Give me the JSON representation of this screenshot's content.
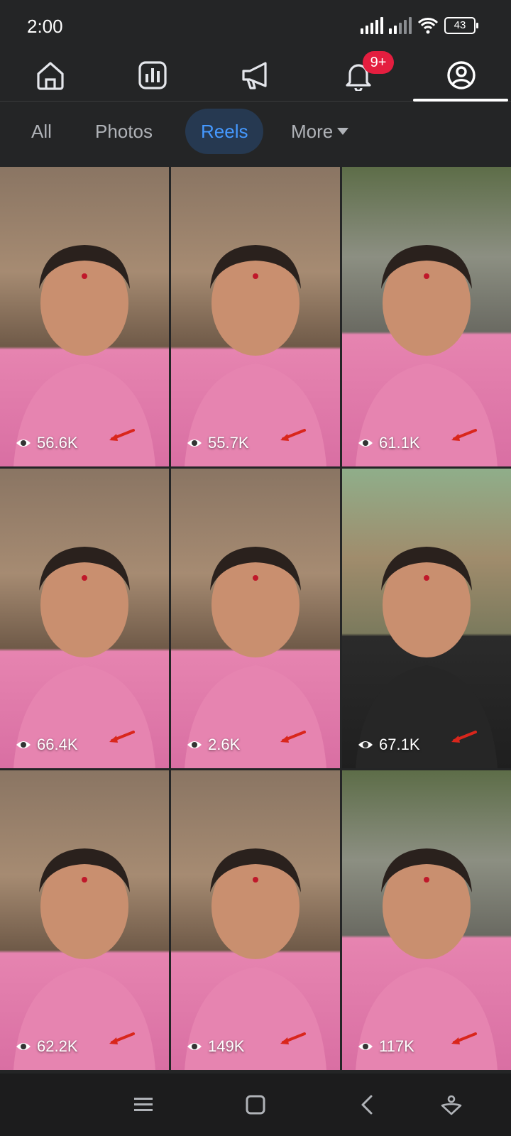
{
  "status_bar": {
    "time": "2:00",
    "battery": "43"
  },
  "nav": {
    "items": [
      {
        "name": "home",
        "icon": "home-icon"
      },
      {
        "name": "dashboard",
        "icon": "bar-chart-icon"
      },
      {
        "name": "ads",
        "icon": "megaphone-icon"
      },
      {
        "name": "notifications",
        "icon": "bell-icon",
        "badge": "9+"
      },
      {
        "name": "profile",
        "icon": "profile-icon",
        "active": true
      }
    ]
  },
  "filters": {
    "all": "All",
    "photos": "Photos",
    "reels": "Reels",
    "more": "More",
    "selected": "Reels"
  },
  "reels": [
    {
      "views": "56.6K",
      "scene": "indoor"
    },
    {
      "views": "55.7K",
      "scene": "indoor"
    },
    {
      "views": "61.1K",
      "scene": "outdoor"
    },
    {
      "views": "66.4K",
      "scene": "indoor"
    },
    {
      "views": "2.6K",
      "scene": "indoor"
    },
    {
      "views": "67.1K",
      "scene": "village"
    },
    {
      "views": "62.2K",
      "scene": "indoor"
    },
    {
      "views": "149K",
      "scene": "indoor"
    },
    {
      "views": "117K",
      "scene": "outdoor"
    }
  ],
  "colors": {
    "background": "#242526",
    "accent": "#4599ff",
    "badge": "#e41e3f",
    "arrow": "#d9261c",
    "outfit": "#e684b0"
  }
}
